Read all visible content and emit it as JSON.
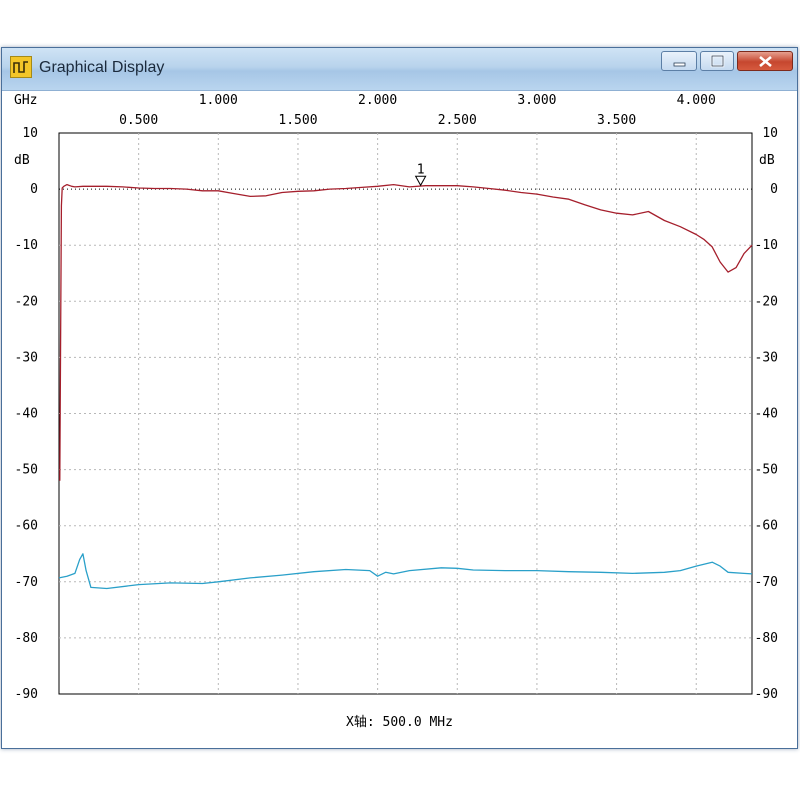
{
  "window": {
    "title": "Graphical Display",
    "icon": "square-wave-icon",
    "controls": [
      "minimize-icon",
      "maximize-icon",
      "close-icon"
    ]
  },
  "colors": {
    "trace_s21": "#a51f2c",
    "trace_s11": "#2aa0c9",
    "grid": "#b8b8b8",
    "reference": "#000000"
  },
  "chart_data": {
    "type": "line",
    "x_unit": "GHz",
    "y_unit": "dB",
    "x_label": "X轴: 500.0 MHz",
    "xlim": [
      0.0,
      4.35
    ],
    "ylim": [
      -90,
      10
    ],
    "x_ticks_top_row": [
      "1.000",
      "2.000",
      "3.000",
      "4.000"
    ],
    "x_ticks_bottom_row": [
      "0.500",
      "1.500",
      "2.500",
      "3.500"
    ],
    "y_ticks": [
      "10",
      "0",
      "-10",
      "-20",
      "-30",
      "-40",
      "-50",
      "-60",
      "-70",
      "-80",
      "-90"
    ],
    "grid": true,
    "reference_line_y": 0,
    "marker": {
      "label": "1",
      "x": 2.27,
      "y": 0.5
    },
    "series": [
      {
        "x": [
          0.005,
          0.01,
          0.015,
          0.02,
          0.03,
          0.05,
          0.08,
          0.1,
          0.15,
          0.2,
          0.3,
          0.4,
          0.5,
          0.6,
          0.7,
          0.8,
          0.9,
          1.0,
          1.1,
          1.2,
          1.3,
          1.4,
          1.5,
          1.6,
          1.7,
          1.8,
          1.9,
          2.0,
          2.1,
          2.2,
          2.3,
          2.4,
          2.5,
          2.6,
          2.7,
          2.8,
          2.9,
          3.0,
          3.1,
          3.2,
          3.3,
          3.4,
          3.5,
          3.6,
          3.7,
          3.8,
          3.9,
          4.0,
          4.05,
          4.1,
          4.15,
          4.2,
          4.25,
          4.3,
          4.35
        ],
        "values": [
          -52,
          -27,
          -3,
          0.2,
          0.5,
          0.8,
          0.5,
          0.4,
          0.5,
          0.5,
          0.5,
          0.4,
          0.2,
          0.1,
          0.1,
          0.0,
          -0.3,
          -0.3,
          -0.8,
          -1.3,
          -1.2,
          -0.6,
          -0.4,
          -0.3,
          0.0,
          0.1,
          0.3,
          0.5,
          0.8,
          0.4,
          0.6,
          0.6,
          0.6,
          0.4,
          0.1,
          -0.2,
          -0.6,
          -0.9,
          -1.4,
          -1.8,
          -2.8,
          -3.7,
          -4.3,
          -4.6,
          -4.0,
          -5.6,
          -6.7,
          -8.1,
          -9.0,
          -10.3,
          -13.0,
          -14.8,
          -14.0,
          -11.5,
          -10.0
        ]
      },
      {
        "x": [
          0.0,
          0.05,
          0.1,
          0.13,
          0.15,
          0.17,
          0.2,
          0.3,
          0.5,
          0.7,
          0.9,
          1.0,
          1.2,
          1.4,
          1.6,
          1.8,
          1.95,
          2.0,
          2.05,
          2.1,
          2.2,
          2.4,
          2.5,
          2.6,
          2.8,
          3.0,
          3.2,
          3.4,
          3.6,
          3.8,
          3.9,
          4.0,
          4.1,
          4.15,
          4.2,
          4.3,
          4.35
        ],
        "values": [
          -69.3,
          -69.0,
          -68.5,
          -66.0,
          -65.0,
          -68.0,
          -71.0,
          -71.2,
          -70.5,
          -70.2,
          -70.3,
          -70.0,
          -69.3,
          -68.8,
          -68.2,
          -67.8,
          -68.0,
          -69.0,
          -68.3,
          -68.6,
          -68.0,
          -67.5,
          -67.6,
          -67.9,
          -68.0,
          -68.0,
          -68.2,
          -68.3,
          -68.5,
          -68.3,
          -68.0,
          -67.2,
          -66.5,
          -67.2,
          -68.3,
          -68.5,
          -68.6
        ]
      }
    ]
  }
}
